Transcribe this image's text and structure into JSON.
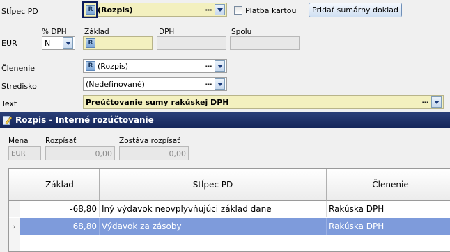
{
  "form": {
    "stlpec_label": "Stĺpec PD",
    "stlpec_value": "(Rozpis)",
    "platba_label": "Platba kartou",
    "pridat_button": "Pridať sumárny doklad",
    "currency_label": "EUR",
    "dph_pct_label": "% DPH",
    "dph_pct_value": "N",
    "zaklad_label": "Základ",
    "dph_label": "DPH",
    "spolu_label": "Spolu",
    "clenenie_label": "Členenie",
    "clenenie_value": "(Rozpis)",
    "stredisko_label": "Stredisko",
    "stredisko_value": "(Nedefinované)",
    "text_label": "Text",
    "text_value": "Preúčtovanie sumy rakúskej DPH",
    "badge": "R",
    "dots": "···"
  },
  "dialog": {
    "title": "Rozpis - Interné rozúčtovanie",
    "mena_label": "Mena",
    "mena_value": "EUR",
    "rozpisat_label": "Rozpísať",
    "rozpisat_value": "0,00",
    "zostava_label": "Zostáva rozpísať",
    "zostava_value": "0,00"
  },
  "grid": {
    "headers": [
      "Základ",
      "Stĺpec PD",
      "Členenie"
    ],
    "rows": [
      {
        "zaklad": "-68,80",
        "stlpec": "Iný výdavok neovplyvňujúci základ dane",
        "clenenie": "Rakúska DPH",
        "selected": false
      },
      {
        "zaklad": "68,80",
        "stlpec": "Výdavok za zásoby",
        "clenenie": "Rakúska DPH",
        "selected": true
      }
    ],
    "current_row_marker": "›"
  },
  "colors": {
    "field_yellow": "#f3f0bf",
    "title_bar": "#1d3068",
    "selected_row": "#7e9bdb"
  }
}
